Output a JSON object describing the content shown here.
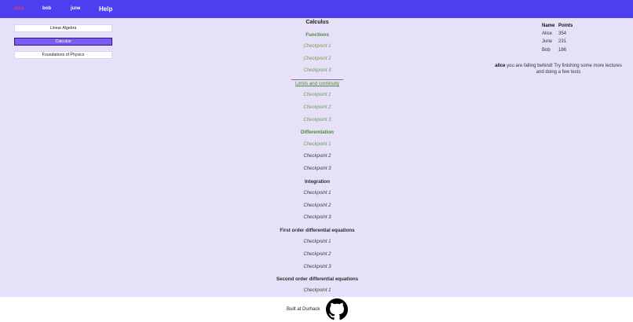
{
  "nav": {
    "items": [
      {
        "label": "alice",
        "active": true
      },
      {
        "label": "bob",
        "active": false
      },
      {
        "label": "june",
        "active": false
      }
    ],
    "help_label": "Help"
  },
  "courses": [
    {
      "label": "Linear Algebra",
      "selected": false
    },
    {
      "label": "Calculus",
      "selected": true
    },
    {
      "label": "Foundations of Physics",
      "selected": false
    }
  ],
  "course_view": {
    "title": "Calculus",
    "topics": [
      {
        "label": "Functions",
        "checkpoints": [
          "Checkpoint 1",
          "Checkpoint 2",
          "Checkpoint 3"
        ]
      },
      {
        "label": "Limits and continuity",
        "checkpoints": [
          "Checkpoint 1",
          "Checkpoint 2",
          "Checkpoint 3"
        ]
      },
      {
        "label": "Differentiation",
        "checkpoints": [
          "Checkpoint 1",
          "Checkpoint 2",
          "Checkpoint 3"
        ]
      },
      {
        "label": "Integration",
        "checkpoints": [
          "Checkpoint 1",
          "Checkpoint 2",
          "Checkpoint 3"
        ]
      },
      {
        "label": "First order differential equations",
        "checkpoints": [
          "Checkpoint 1",
          "Checkpoint 2",
          "Checkpoint 3"
        ]
      },
      {
        "label": "Second order differential equations",
        "checkpoints": [
          "Checkpoint 1"
        ]
      }
    ]
  },
  "leaderboard": {
    "headers": [
      "Name",
      "Points"
    ],
    "rows": [
      {
        "name": "Alice",
        "points": "354"
      },
      {
        "name": "June",
        "points": "231"
      },
      {
        "name": "Bob",
        "points": "186"
      }
    ]
  },
  "message": {
    "user": "alice",
    "text": "you are falling behind! Try finishing some more lectures and doing a few tests"
  },
  "footer": {
    "built_text": "Built at Durhack"
  },
  "colors": {
    "topbar": "#4b3ff0",
    "active_nav": "#e83a62",
    "selected_course": "#7c5cf0",
    "completed_green": "#6c9a55",
    "background": "#e6e1f8"
  },
  "icons": {
    "footer": "github-icon"
  }
}
